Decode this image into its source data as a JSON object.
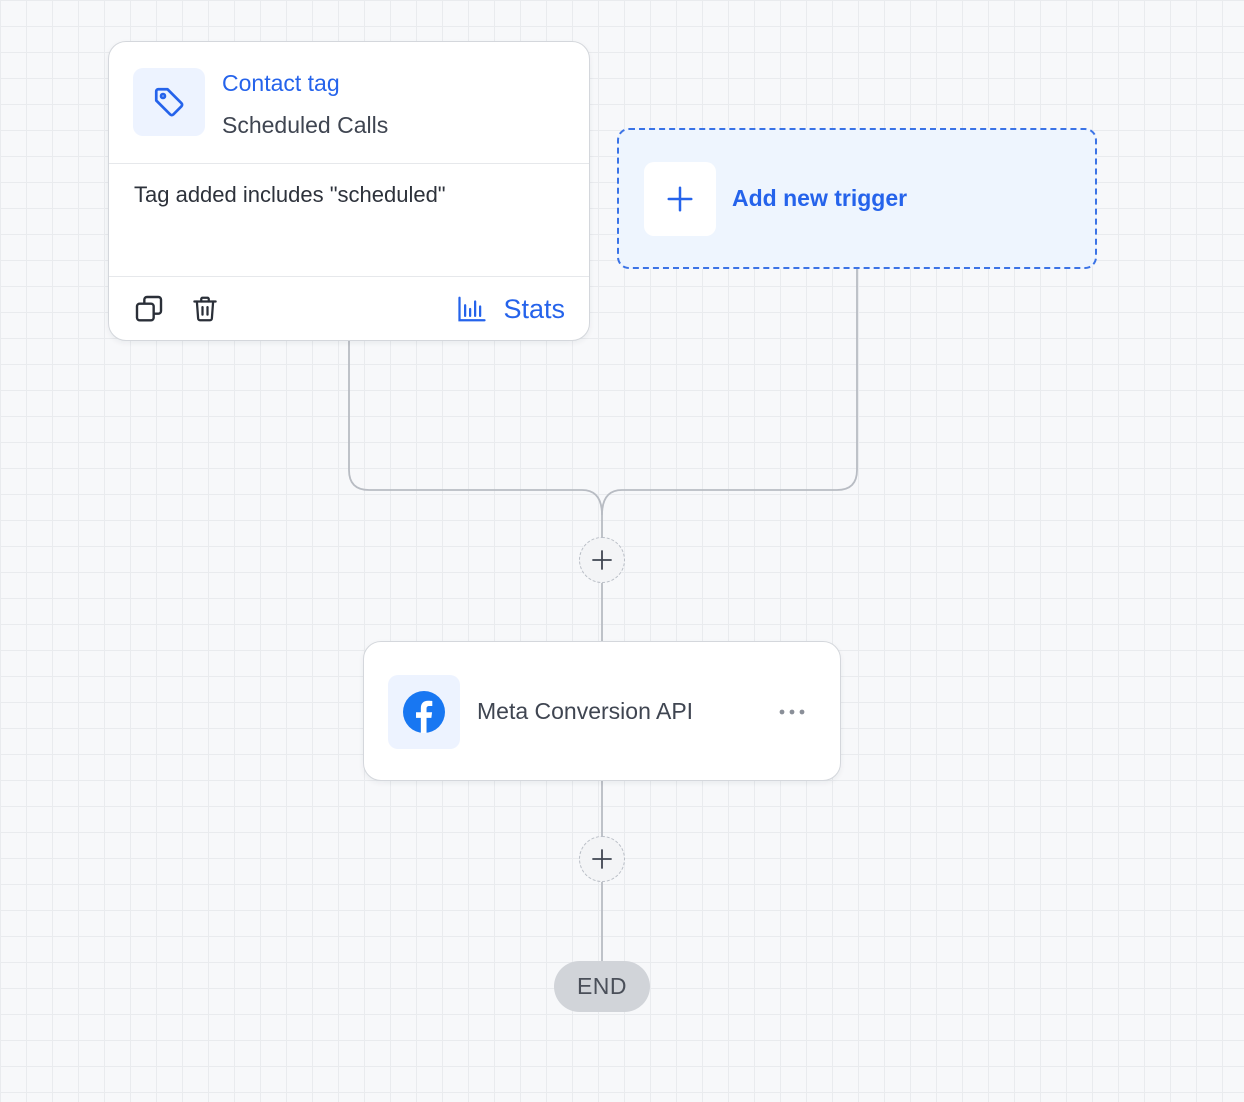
{
  "trigger": {
    "title": "Contact tag",
    "subtitle": "Scheduled Calls",
    "condition": "Tag added includes \"scheduled\"",
    "stats_label": "Stats",
    "icon": "tag-icon"
  },
  "add_trigger": {
    "label": "Add new trigger",
    "icon": "plus-icon"
  },
  "action": {
    "label": "Meta Conversion API",
    "icon": "facebook-icon"
  },
  "end": {
    "label": "END"
  },
  "colors": {
    "accent": "#2563eb",
    "facebook": "#1877f2",
    "canvas": "#f7f8fa",
    "end_pill": "#d1d4d9"
  }
}
